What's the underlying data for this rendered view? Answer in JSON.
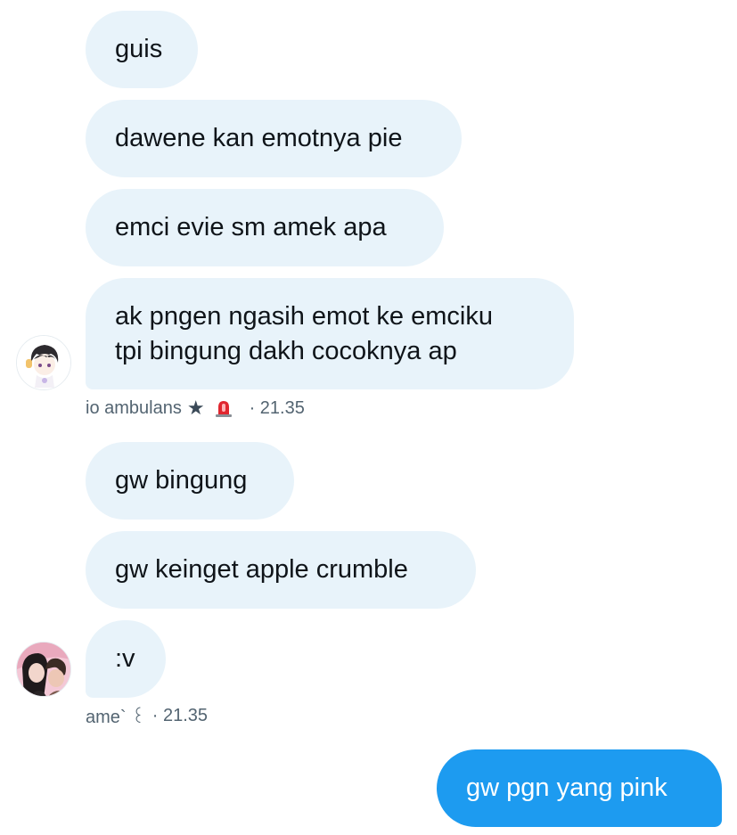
{
  "conversation": {
    "group1": {
      "messages": [
        {
          "text": "guis"
        },
        {
          "text": "dawene kan emotnya pie"
        },
        {
          "text": "emci evie sm amek apa"
        },
        {
          "lines": [
            "ak pngen ngasih emot ke emciku",
            "tpi bingung dakh cocoknya ap"
          ]
        }
      ],
      "sender": {
        "name": "io ambulans",
        "badge_icon": "star-icon",
        "emoji_icon": "siren-icon",
        "time": "· 21.35"
      }
    },
    "group2": {
      "messages": [
        {
          "text": "gw bingung"
        },
        {
          "text": "gw keinget apple crumble"
        },
        {
          "text": ":v"
        }
      ],
      "sender": {
        "name": "ame` ꒰",
        "time": "· 21.35"
      }
    },
    "own": {
      "messages": [
        {
          "text": "gw pgn yang pink"
        }
      ]
    }
  },
  "colors": {
    "incoming_bubble": "#e8f3fa",
    "outgoing_bubble": "#1d9bf0",
    "meta_text": "#536471"
  }
}
